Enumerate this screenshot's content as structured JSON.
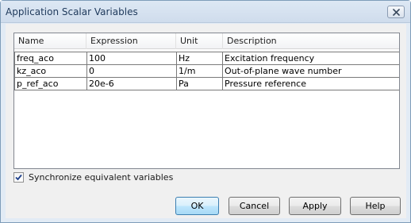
{
  "window": {
    "title": "Application Scalar Variables"
  },
  "table": {
    "columns": [
      "Name",
      "Expression",
      "Unit",
      "Description"
    ],
    "rows": [
      [
        "freq_aco",
        "100",
        "Hz",
        "Excitation frequency"
      ],
      [
        "kz_aco",
        "0",
        "1/m",
        "Out-of-plane wave number"
      ],
      [
        "p_ref_aco",
        "20e-6",
        "Pa",
        "Pressure reference"
      ]
    ]
  },
  "sync": {
    "label": "Synchronize equivalent variables",
    "checked": true
  },
  "buttons": {
    "ok": "OK",
    "cancel": "Cancel",
    "apply": "Apply",
    "help": "Help"
  },
  "icons": {
    "close": "close-icon",
    "check": "checkmark-icon"
  }
}
